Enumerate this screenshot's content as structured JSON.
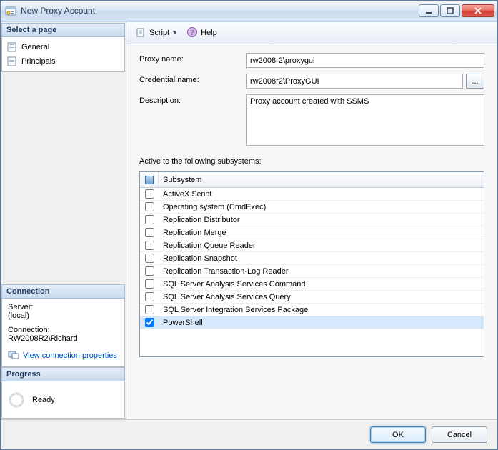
{
  "window": {
    "title": "New Proxy Account"
  },
  "sidebar": {
    "select_page_header": "Select a page",
    "pages": [
      {
        "label": "General"
      },
      {
        "label": "Principals"
      }
    ],
    "connection_header": "Connection",
    "server_label": "Server:",
    "server_value": "(local)",
    "connection_label": "Connection:",
    "connection_value": "RW2008R2\\Richard",
    "view_connection_link": "View connection properties",
    "progress_header": "Progress",
    "progress_status": "Ready"
  },
  "toolbar": {
    "script_label": "Script",
    "help_label": "Help"
  },
  "form": {
    "proxy_name_label": "Proxy name:",
    "proxy_name_value": "rw2008r2\\proxygui",
    "credential_name_label": "Credential name:",
    "credential_name_value": "rw2008r2\\ProxyGUI",
    "ellipsis": "...",
    "description_label": "Description:",
    "description_value": "Proxy account created with SSMS",
    "subsystems_label": "Active to the following subsystems:",
    "grid_header": "Subsystem",
    "subsystems": [
      {
        "label": "ActiveX Script",
        "checked": false
      },
      {
        "label": "Operating system (CmdExec)",
        "checked": false
      },
      {
        "label": "Replication Distributor",
        "checked": false
      },
      {
        "label": "Replication Merge",
        "checked": false
      },
      {
        "label": "Replication Queue Reader",
        "checked": false
      },
      {
        "label": "Replication Snapshot",
        "checked": false
      },
      {
        "label": "Replication Transaction-Log Reader",
        "checked": false
      },
      {
        "label": "SQL Server Analysis Services Command",
        "checked": false
      },
      {
        "label": "SQL Server Analysis Services Query",
        "checked": false
      },
      {
        "label": "SQL Server Integration Services Package",
        "checked": false
      },
      {
        "label": "PowerShell",
        "checked": true
      }
    ]
  },
  "footer": {
    "ok_label": "OK",
    "cancel_label": "Cancel"
  }
}
